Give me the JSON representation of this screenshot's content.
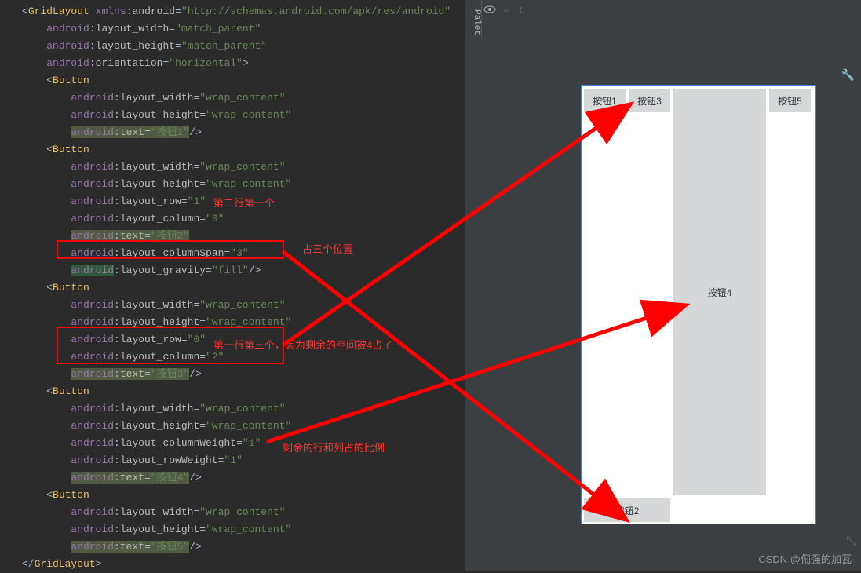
{
  "code": {
    "root_open": "GridLayout",
    "xmlns_ns": "xmlns",
    "xmlns_attr": "android",
    "xmlns_val": "\"http://schemas.android.com/apk/res/android\"",
    "ns": "android",
    "attrs": {
      "lw": "layout_width",
      "lh": "layout_height",
      "ori": "orientation",
      "lr": "layout_row",
      "lc": "layout_column",
      "lcs": "layout_columnSpan",
      "lg": "layout_gravity",
      "lcw": "layout_columnWeight",
      "lrw": "layout_rowWeight",
      "txt": "text"
    },
    "vals": {
      "mp": "\"match_parent\"",
      "wc": "\"wrap_content\"",
      "hor": "\"horizontal\"",
      "r1": "\"1\"",
      "r0": "\"0\"",
      "c0": "\"0\"",
      "c2": "\"2\"",
      "cs3": "\"3\"",
      "fill": "\"fill\"",
      "w1": "\"1\"",
      "b1": "\"按钮1\"",
      "b2": "\"按钮2\"",
      "b3": "\"按钮3\"",
      "b4": "\"按钮4\"",
      "b5": "\"按钮5\""
    },
    "btn": "Button",
    "close": "GridLayout"
  },
  "annotations": {
    "a1": "第二行第一个",
    "a2": "占三个位置",
    "a3": "第一行第三个，因为剩余的空间被4占了",
    "a4": "剩余的行和列占的比例"
  },
  "preview": {
    "b1": "按钮1",
    "b2": "按钮2",
    "b3": "按钮3",
    "b4": "按钮4",
    "b5": "按钮5"
  },
  "palette": "Palet",
  "watermark": "CSDN @倔强的加瓦"
}
